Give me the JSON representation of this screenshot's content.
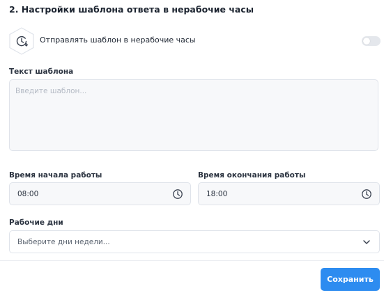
{
  "section": {
    "title": "2. Настройки шаблона ответа в нерабочие часы"
  },
  "toggle": {
    "label": "Отправлять шаблон в нерабочие часы",
    "enabled": false
  },
  "template": {
    "label": "Текст шаблона",
    "placeholder": "Введите шаблон...",
    "value": ""
  },
  "start_time": {
    "label": "Время начала работы",
    "value": "08:00"
  },
  "end_time": {
    "label": "Время окончания работы",
    "value": "18:00"
  },
  "work_days": {
    "label": "Рабочие дни",
    "placeholder": "Выберите дни недели..."
  },
  "actions": {
    "save_label": "Сохранить"
  },
  "icons": {
    "hex_badge": "clock-arrow-icon",
    "time": "clock-icon",
    "dropdown": "chevron-down-icon"
  },
  "colors": {
    "accent": "#2d8cf0",
    "toggle_off": "#e4e7ec",
    "field_bg": "#f7f8fa",
    "border": "#dfe3ea"
  }
}
